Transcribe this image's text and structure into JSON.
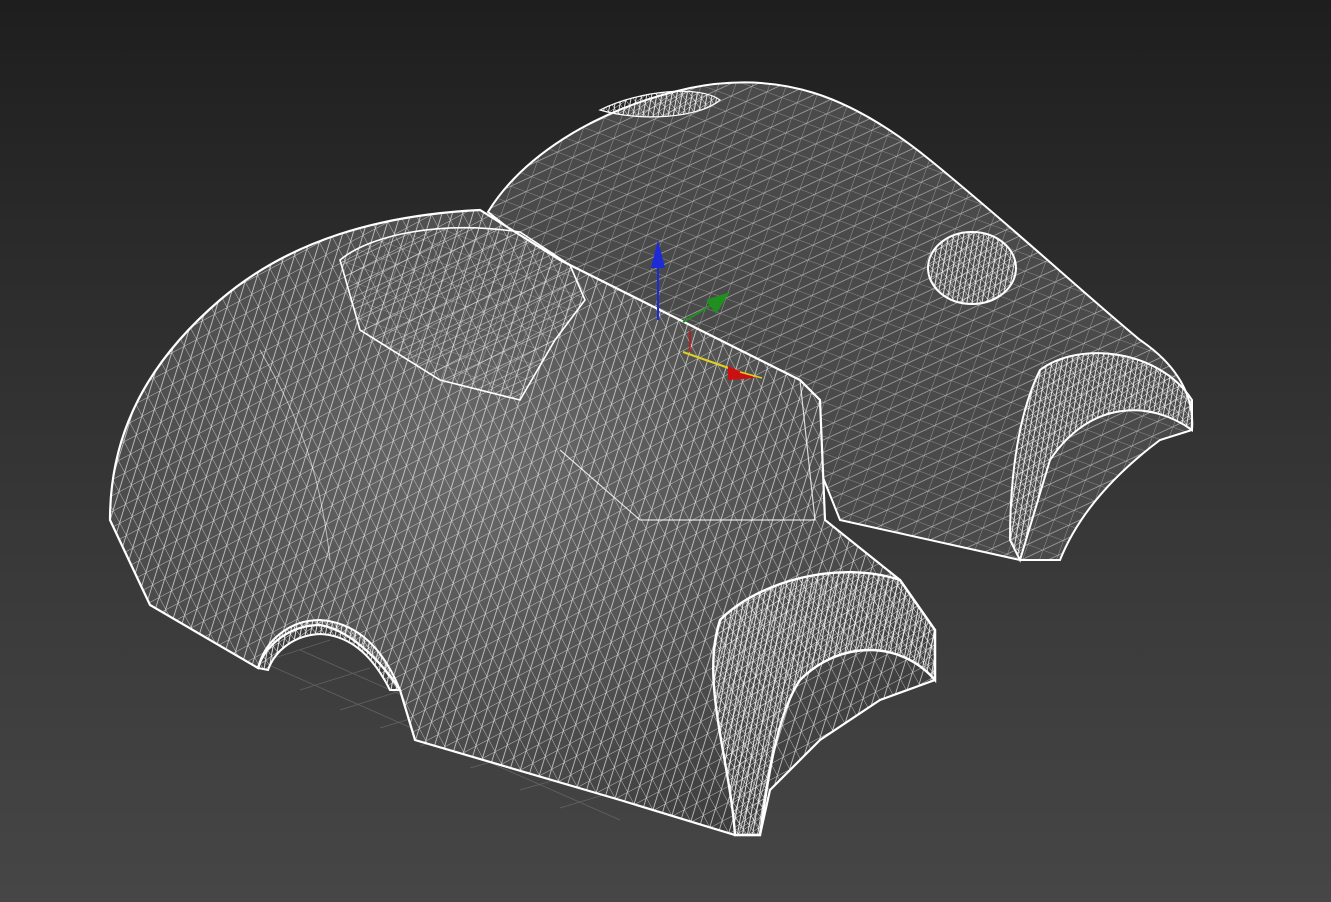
{
  "viewport": {
    "background_top": "#1e1e1e",
    "background_bottom": "#464646",
    "render_mode": "wireframe",
    "wire_color": "#ffffff",
    "grid_color": "#6b6b6b"
  },
  "scene": {
    "objects": [
      "mesh-front-cover",
      "mesh-back-cover"
    ]
  },
  "gizmo": {
    "type": "move-transform",
    "axis_colors": {
      "x": "#cc1010",
      "y": "#1f8f1f",
      "z": "#1c2bd6",
      "plane": "#e0d020"
    }
  }
}
